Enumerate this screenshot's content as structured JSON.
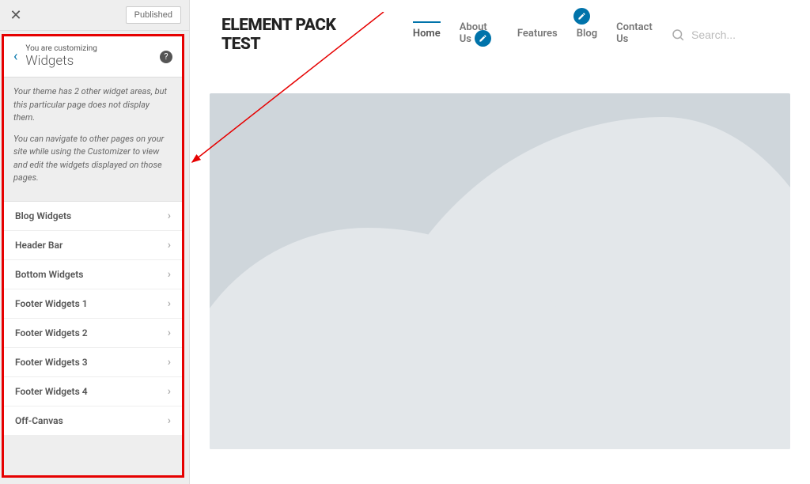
{
  "sidebar": {
    "published_label": "Published",
    "customizing_label": "You are customizing",
    "panel_title": "Widgets",
    "info_para1": "Your theme has 2 other widget areas, but this particular page does not display them.",
    "info_para2": "You can navigate to other pages on your site while using the Customizer to view and edit the widgets displayed on those pages.",
    "items": [
      {
        "label": "Blog Widgets"
      },
      {
        "label": "Header Bar"
      },
      {
        "label": "Bottom Widgets"
      },
      {
        "label": "Footer Widgets 1"
      },
      {
        "label": "Footer Widgets 2"
      },
      {
        "label": "Footer Widgets 3"
      },
      {
        "label": "Footer Widgets 4"
      },
      {
        "label": "Off-Canvas"
      }
    ]
  },
  "site": {
    "title": "ELEMENT PACK TEST",
    "nav": [
      {
        "label": "Home",
        "active": true
      },
      {
        "label": "About Us",
        "active": false
      },
      {
        "label": "Features",
        "active": false
      },
      {
        "label": "Blog",
        "active": false
      },
      {
        "label": "Contact Us",
        "active": false
      }
    ],
    "search_placeholder": "Search..."
  }
}
